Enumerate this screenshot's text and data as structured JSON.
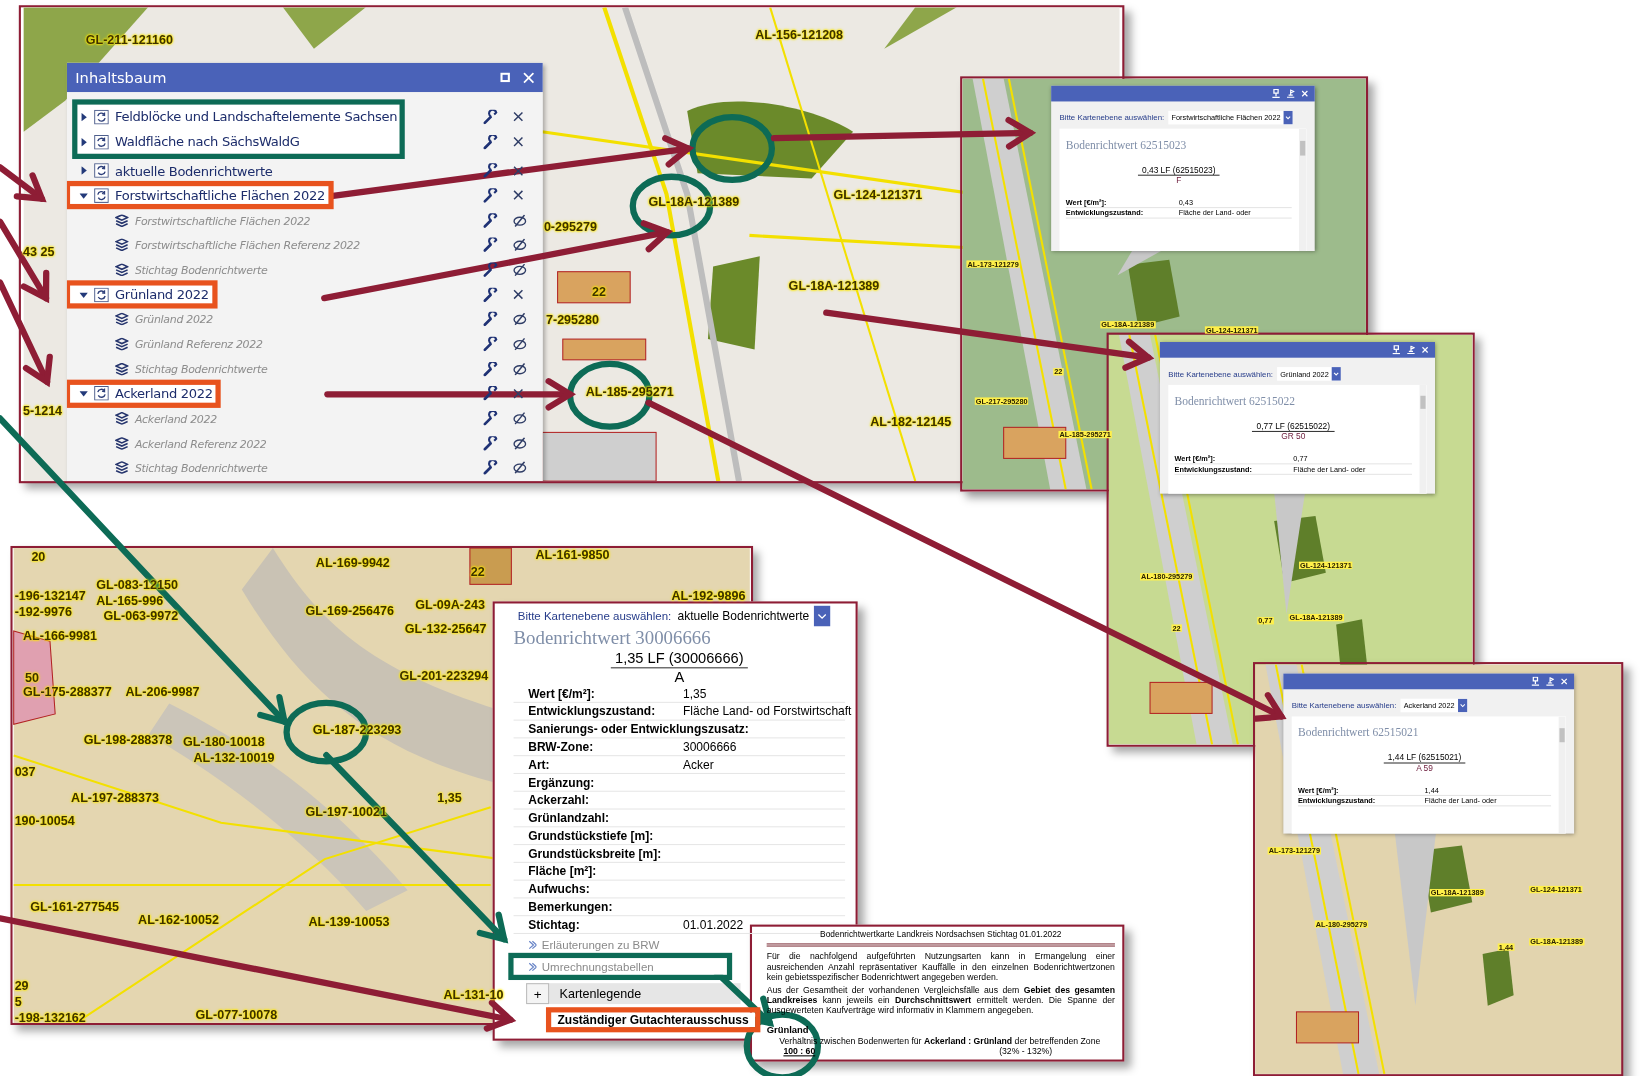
{
  "top_map": {
    "labels": [
      "GL-211-121160",
      "AL-156-121208",
      "GL-124-121371",
      "GL-18A-121389",
      "GL-18A-121389",
      "AL-182-12145",
      "AL-185-295271",
      "0-295279",
      "7-295280",
      "22",
      "43 25",
      "5-1214"
    ]
  },
  "tree_panel": {
    "title": "Inhaltsbaum",
    "items": [
      {
        "kind": "layer",
        "label": "Feldblöcke und Landschaftelemente Sachsen",
        "expanded": false
      },
      {
        "kind": "layer",
        "label": "Waldfläche nach SächsWaldG",
        "expanded": false
      },
      {
        "kind": "layer",
        "label": "aktuelle Bodenrichtwerte",
        "expanded": false
      },
      {
        "kind": "layer",
        "label": "Forstwirtschaftliche Flächen 2022",
        "expanded": true,
        "children": [
          {
            "kind": "sublayer",
            "label": "Forstwirtschaftliche Flächen 2022"
          },
          {
            "kind": "sublayer",
            "label": "Forstwirtschaftliche Flächen Referenz 2022"
          },
          {
            "kind": "sublayer",
            "label": "Stichtag Bodenrichtwerte"
          }
        ]
      },
      {
        "kind": "layer",
        "label": "Grünland 2022",
        "expanded": true,
        "children": [
          {
            "kind": "sublayer",
            "label": "Grünland 2022"
          },
          {
            "kind": "sublayer",
            "label": "Grünland Referenz 2022"
          },
          {
            "kind": "sublayer",
            "label": "Stichtag Bodenrichtwerte"
          }
        ]
      },
      {
        "kind": "layer",
        "label": "Ackerland 2022",
        "expanded": true,
        "children": [
          {
            "kind": "sublayer",
            "label": "Ackerland 2022"
          },
          {
            "kind": "sublayer",
            "label": "Ackerland Referenz 2022"
          },
          {
            "kind": "sublayer",
            "label": "Stichtag Bodenrichtwerte"
          }
        ]
      }
    ]
  },
  "detail_maps": [
    {
      "labels": [
        "AL-173-121279",
        "GL-18A-121389",
        "GL-124-121371",
        "22",
        "GL-217-295280",
        "AL-185-295271"
      ],
      "popup": {
        "select_label": "Bitte Kartenebene auswählen:",
        "select_value": "Forstwirtschaftliche Flächen 2022",
        "title": "Bodenrichtwert 62515023",
        "value_line": "0,43 LF (62515023)",
        "class_line": "F",
        "rows": [
          {
            "label": "Wert [€/m²]:",
            "value": "0,43"
          },
          {
            "label": "Entwicklungszustand:",
            "value": "Fläche der Land- oder"
          }
        ]
      }
    },
    {
      "labels": [
        "GL-18A-121389",
        "GL-124-121371",
        "AL-180-295279",
        "22",
        "0,77"
      ],
      "popup": {
        "select_label": "Bitte Kartenebene auswählen:",
        "select_value": "Grünland 2022",
        "title": "Bodenrichtwert 62515022",
        "value_line": "0,77 LF (62515022)",
        "class_line": "GR 50",
        "rows": [
          {
            "label": "Wert [€/m²]:",
            "value": "0,77"
          },
          {
            "label": "Entwicklungszustand:",
            "value": "Fläche der Land- oder"
          }
        ]
      }
    },
    {
      "labels": [
        "AL-173-121279",
        "GL-18A-121389",
        "GL-124-121371",
        "AL-180-295279",
        "1,44",
        "GL-18A-121389"
      ],
      "popup": {
        "select_label": "Bitte Kartenebene auswählen:",
        "select_value": "Ackerland 2022",
        "title": "Bodenrichtwert 62515021",
        "value_line": "1,44 LF (62515021)",
        "class_line": "A 59",
        "rows": [
          {
            "label": "Wert [€/m²]:",
            "value": "1,44"
          },
          {
            "label": "Entwicklungszustand:",
            "value": "Fläche der Land- oder"
          }
        ]
      }
    }
  ],
  "bottom_map": {
    "labels": [
      "20",
      "AL-169-9942",
      "AL-161-9850",
      "22",
      "GL-083-12150",
      "-196-132147",
      "AL-165-996",
      "-192-9976",
      "GL-063-9972",
      "GL-169-256476",
      "GL-09A-243",
      "AL-192-9896",
      "GL-132-25647",
      "AL-166-9981",
      "50",
      "GL-201-223294",
      "GL-175-288377",
      "AL-206-9987",
      "GL-187-223293",
      "GL-198-288378",
      "GL-180-10018",
      "AL-132-10019",
      "037",
      "AL-197-288373",
      "1,35",
      "GL-197-10021",
      "190-10054",
      "AL-131-10",
      "GL-161-277545",
      "AL-162-10052",
      "AL-139-10053",
      "29",
      "5",
      "-198-132162",
      "GL-077-10078"
    ]
  },
  "info_panel": {
    "select_label": "Bitte Kartenebene auswählen:",
    "select_value": "aktuelle Bodenrichtwerte",
    "title": "Bodenrichtwert 30006666",
    "value_line": "1,35 LF (30006666)",
    "class_line": "A",
    "rows": [
      {
        "label": "Wert [€/m²]:",
        "value": "1,35"
      },
      {
        "label": "Entwicklungszustand:",
        "value": "Fläche Land- od Forstwirtschaft"
      },
      {
        "label": "Sanierungs- oder Entwicklungszusatz:"
      },
      {
        "label": "BRW-Zone:",
        "value": "30006666"
      },
      {
        "label": "Art:",
        "value": "Acker"
      },
      {
        "label": "Ergänzung:"
      },
      {
        "label": "Ackerzahl:"
      },
      {
        "label": "Grünlandzahl:"
      },
      {
        "label": "Grundstückstiefe [m]:"
      },
      {
        "label": "Grundstücksbreite [m]:"
      },
      {
        "label": "Fläche [m²]:"
      },
      {
        "label": "Aufwuchs:"
      },
      {
        "label": "Bemerkungen:"
      },
      {
        "label": "Stichtag:",
        "value": "01.01.2022"
      }
    ],
    "links": [
      "Erläuterungen zu BRW",
      "Umrechnungstabellen"
    ],
    "legend": {
      "symbol": "+",
      "label": "Kartenlegende"
    },
    "button": "Zuständiger Gutachterausschuss"
  },
  "note": {
    "title": "Bodenrichtwertkarte Landkreis Nordsachsen Stichtag 01.01.2022",
    "paragraphs": [
      "Für die nachfolgend aufgeführten Nutzungsarten kann in Ermangelung einer ausreichenden Anzahl repräsentativer Kauffälle in den einzelnen Bodenrichtwertzonen kein gebietsspezifischer Bodenrichtwert angegeben werden.",
      "Aus der Gesamtheit der vorhandenen Vergleichsfälle aus dem **Gebiet des gesamten Landkreises** kann jeweils ein **Durchschnittswert** ermittelt werden. Die Spanne der ausgewerteten Kaufverträge wird informativ in Klammern angegeben."
    ],
    "section": "Grünland",
    "ratio_text": "Verhältnis zwischen Bodenwerten für **Ackerland : Grünland** der betreffenden Zone",
    "ratio": "100 : 60",
    "range": "(32% - 132%)"
  }
}
